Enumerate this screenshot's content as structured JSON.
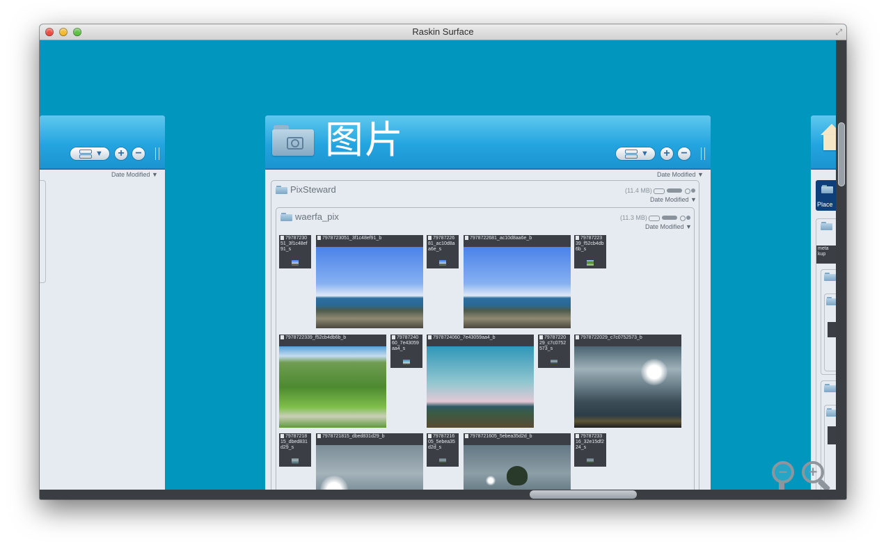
{
  "window": {
    "title": "Raskin Surface"
  },
  "left_panel": {
    "sort_label": "Date Modified ▼"
  },
  "main_panel": {
    "title": "图片",
    "sort_label": "Date Modified ▼",
    "view_arrow": "▼",
    "add_label": "+",
    "remove_label": "−",
    "groups": [
      {
        "name": "PixSteward",
        "size": "(11.4 MB)",
        "sort_label": "Date Modified ▼"
      },
      {
        "name": "waerfa_pix",
        "size": "(11.3 MB)",
        "sort_label": "Date Modified ▼"
      }
    ],
    "thumbs": [
      "7978723051_3f1c48ef91_s",
      "7978723051_3f1c48ef91_b",
      "7978722681_ac10d8aa6e_s",
      "7978722681_ac10d8aa6e_b",
      "7978722339_f52cb4db6b_s",
      "7978722339_f52cb4db6b_b",
      "7978724060_7e43059aa4_s",
      "7978724060_7e43059aa4_b",
      "7978722029_c7c0752573_s",
      "7978722029_c7c0752573_b",
      "7978721815_dbed831d29_s",
      "7978721815_dbed831d29_b",
      "7978721605_5ebea35d2d_s",
      "7978721605_5ebea35d2d_b",
      "7978723316_32e15df224_s"
    ]
  },
  "right_panel": {
    "item_label": "Place",
    "item2_label": "meta kup"
  },
  "zoom": {
    "out_label": "−",
    "in_label": "+"
  },
  "colors": {
    "background": "#0096bd",
    "header": "#23a4df",
    "panel": "#e6eaf1"
  }
}
